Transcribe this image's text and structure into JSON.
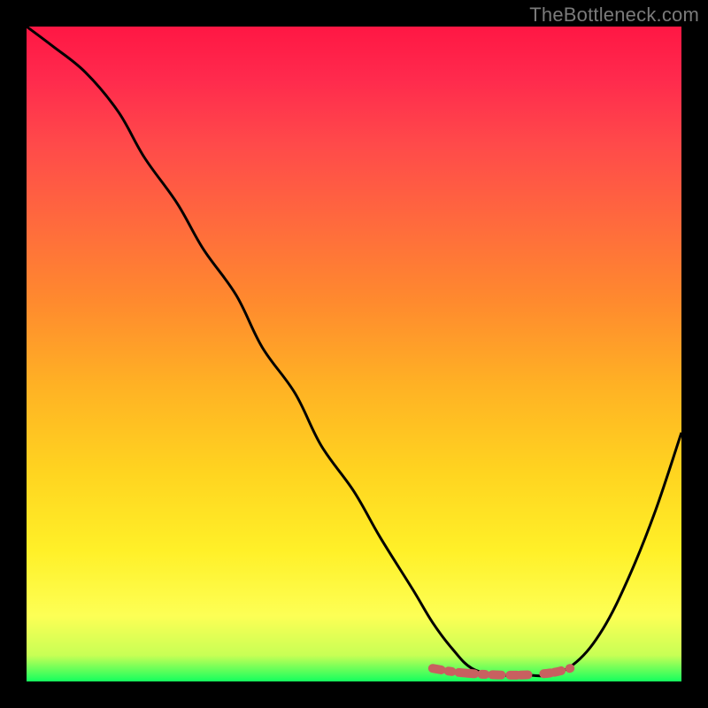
{
  "watermark": "TheBottleneck.com",
  "chart_data": {
    "type": "line",
    "title": "",
    "xlabel": "",
    "ylabel": "",
    "xlim": [
      0,
      100
    ],
    "ylim": [
      0,
      100
    ],
    "grid": false,
    "legend": false,
    "series": [
      {
        "name": "bottleneck-curve",
        "x": [
          0,
          4,
          9,
          14,
          18,
          23,
          27,
          32,
          36,
          41,
          45,
          50,
          54,
          59,
          62,
          65,
          68,
          72,
          76,
          80,
          84,
          88,
          92,
          96,
          100
        ],
        "y": [
          100,
          97,
          93,
          87,
          80,
          73,
          66,
          59,
          51,
          44,
          36,
          29,
          22,
          14,
          9,
          5,
          2,
          1,
          1,
          1,
          3,
          8,
          16,
          26,
          38
        ]
      },
      {
        "name": "optimal-band",
        "x": [
          62,
          65,
          68,
          72,
          76,
          80,
          83
        ],
        "y": [
          2,
          1.5,
          1.2,
          1.0,
          1.0,
          1.3,
          2
        ]
      }
    ],
    "gradient_stops": [
      {
        "offset": 0.0,
        "color": "#ff1744"
      },
      {
        "offset": 0.08,
        "color": "#ff2a4d"
      },
      {
        "offset": 0.18,
        "color": "#ff4a4a"
      },
      {
        "offset": 0.3,
        "color": "#ff6a3d"
      },
      {
        "offset": 0.42,
        "color": "#ff8a2e"
      },
      {
        "offset": 0.55,
        "color": "#ffb224"
      },
      {
        "offset": 0.68,
        "color": "#ffd420"
      },
      {
        "offset": 0.8,
        "color": "#fff028"
      },
      {
        "offset": 0.9,
        "color": "#fdff55"
      },
      {
        "offset": 0.96,
        "color": "#c8ff55"
      },
      {
        "offset": 1.0,
        "color": "#14ff5e"
      }
    ],
    "curve_stroke": "#000000",
    "band_stroke": "#c86060",
    "band_stroke_width": 10,
    "curve_stroke_width": 3
  }
}
